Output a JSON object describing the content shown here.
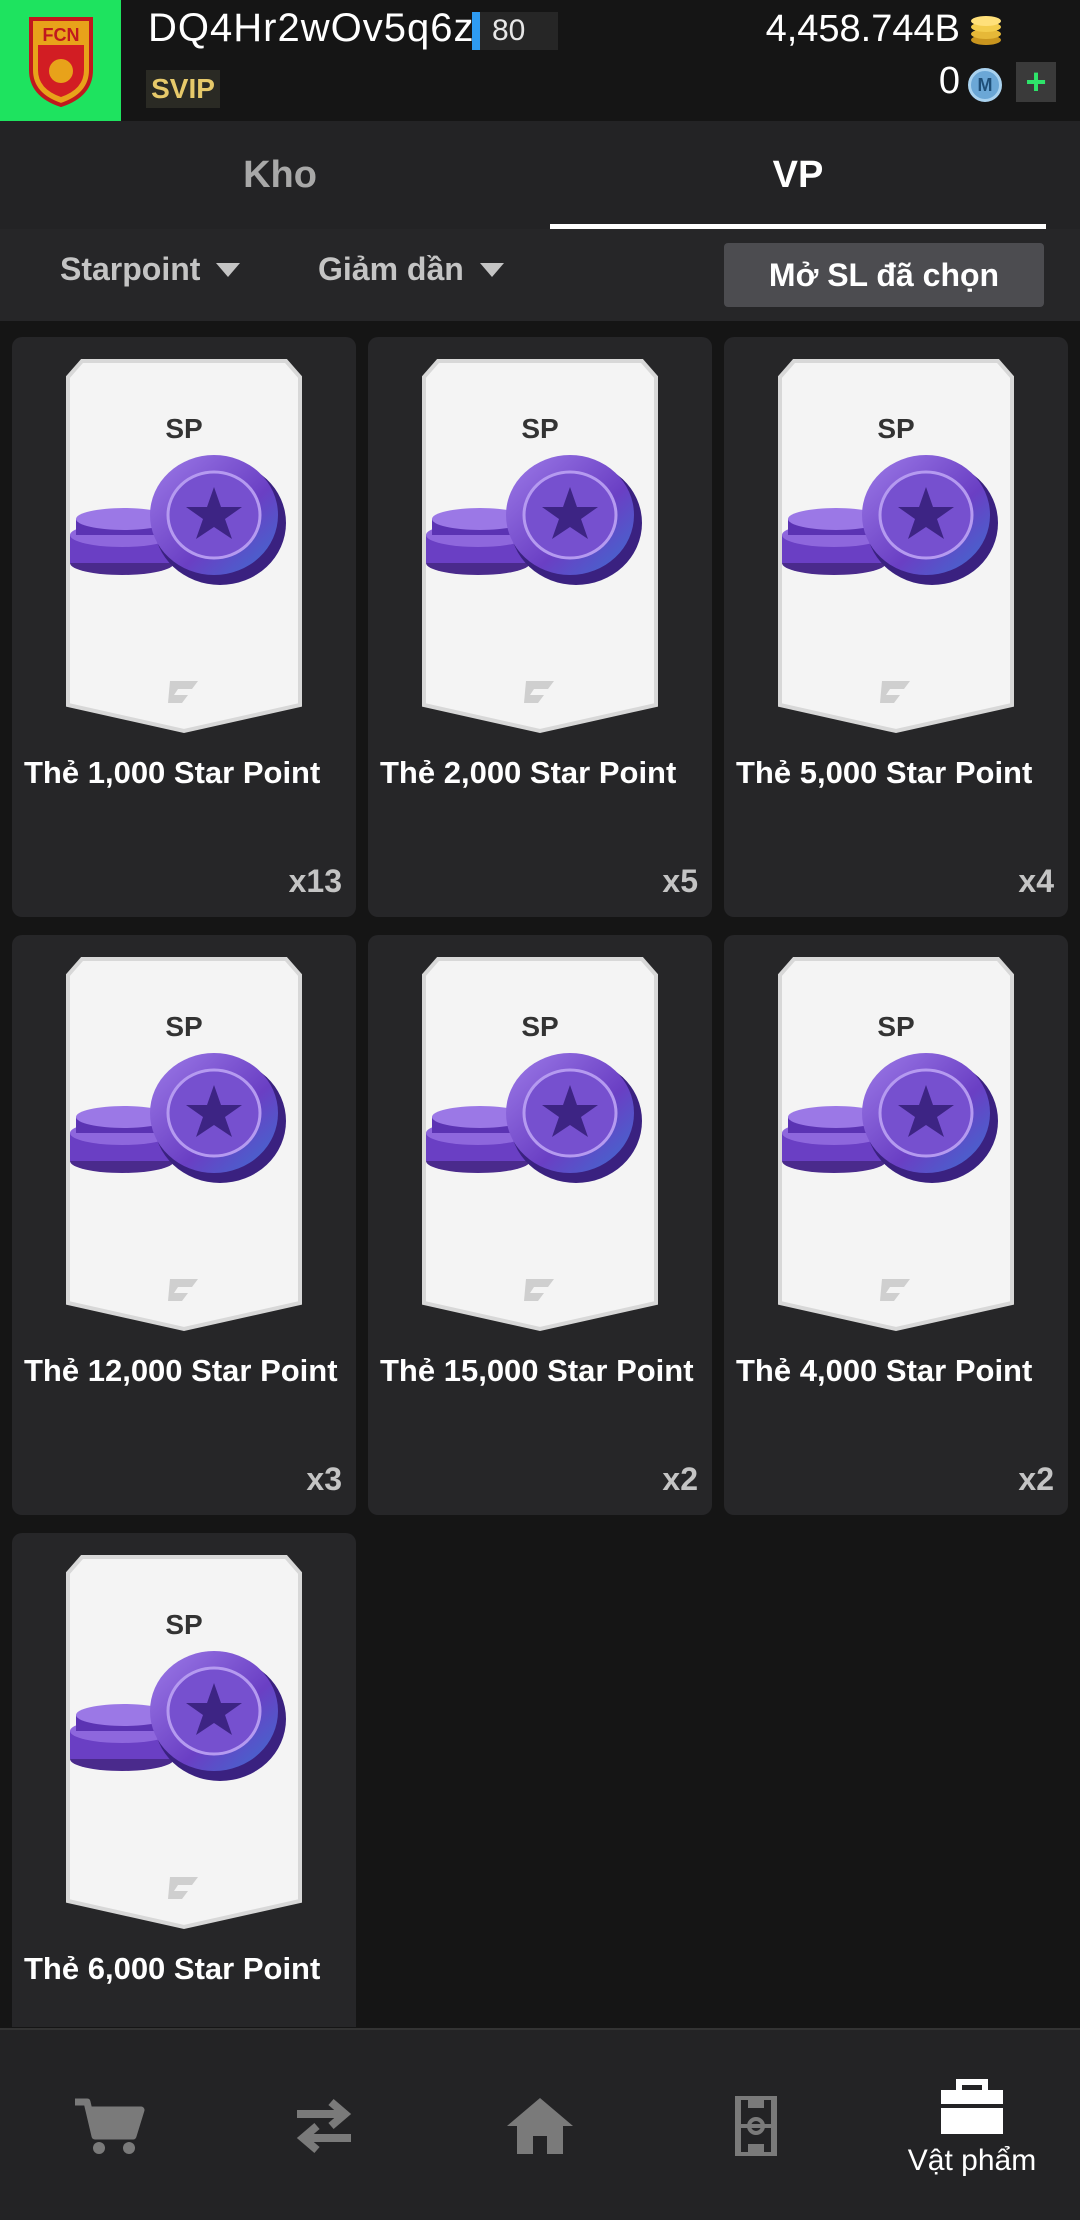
{
  "header": {
    "username": "DQ4Hr2wOv5q6z",
    "level": "80",
    "vip_badge": "SVIP",
    "balance": "4,458.744B",
    "m_coins": "0",
    "m_icon_letter": "M",
    "plus_label": "+",
    "logo_text": "FCN"
  },
  "tabs": [
    {
      "label": "Kho",
      "active": false
    },
    {
      "label": "VP",
      "active": true
    }
  ],
  "filters": {
    "sort_field": "Starpoint",
    "sort_order": "Giảm dần",
    "open_selected_button": "Mở SL đã chọn"
  },
  "items": [
    {
      "card_label": "SP",
      "name": "Thẻ 1,000 Star Point",
      "quantity": "x13"
    },
    {
      "card_label": "SP",
      "name": "Thẻ 2,000 Star Point",
      "quantity": "x5"
    },
    {
      "card_label": "SP",
      "name": "Thẻ 5,000 Star Point",
      "quantity": "x4"
    },
    {
      "card_label": "SP",
      "name": "Thẻ 12,000 Star Point",
      "quantity": "x3"
    },
    {
      "card_label": "SP",
      "name": "Thẻ 15,000 Star Point",
      "quantity": "x2"
    },
    {
      "card_label": "SP",
      "name": "Thẻ 4,000 Star Point",
      "quantity": "x2"
    },
    {
      "card_label": "SP",
      "name": "Thẻ 6,000 Star Point",
      "quantity": ""
    }
  ],
  "bottom_nav": [
    {
      "icon": "cart-icon",
      "label": "",
      "active": false
    },
    {
      "icon": "transfer-icon",
      "label": "",
      "active": false
    },
    {
      "icon": "home-icon",
      "label": "",
      "active": false
    },
    {
      "icon": "pitch-icon",
      "label": "",
      "active": false
    },
    {
      "icon": "bag-icon",
      "label": "Vật phẩm",
      "active": true
    }
  ],
  "colors": {
    "logo_bg": "#1ee35f",
    "level_bar": "#2e9bf2",
    "coin_purple": "#7b4fd1",
    "plus_green": "#2ee36a"
  }
}
